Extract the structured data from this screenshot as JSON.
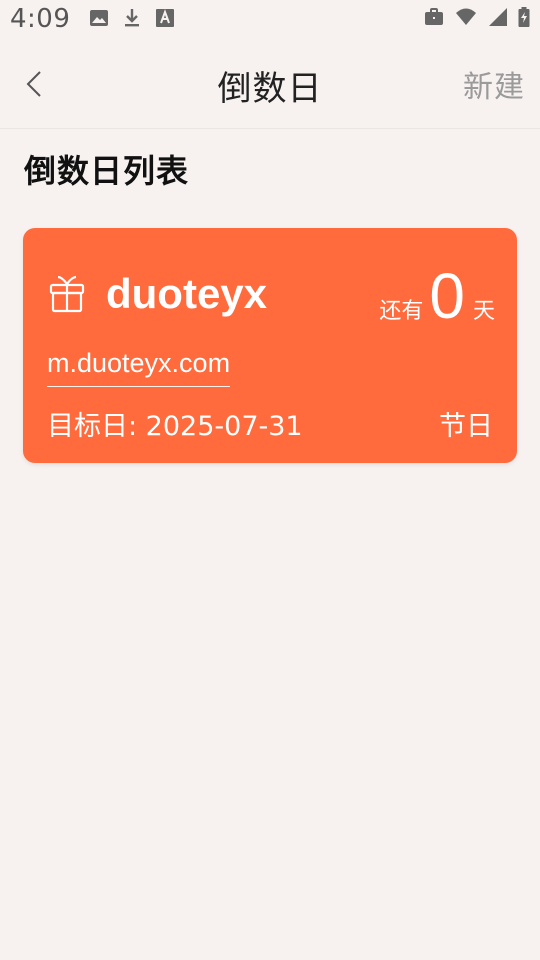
{
  "status_bar": {
    "time": "4:09",
    "left_icons": [
      "image-icon",
      "download-icon",
      "font-a-icon"
    ],
    "right_icons": [
      "briefcase-icon",
      "wifi-icon",
      "signal-icon",
      "battery-icon"
    ]
  },
  "app_bar": {
    "back_icon": "chevron-left-icon",
    "title": "倒数日",
    "action_label": "新建"
  },
  "section": {
    "title": "倒数日列表"
  },
  "card": {
    "icon": "gift-icon",
    "title": "duoteyx",
    "remaining_prefix": "还有",
    "remaining_days": "0",
    "remaining_unit": "天",
    "subtitle": "m.duoteyx.com",
    "target_date_label": "目标日: 2025-07-31",
    "category": "节日",
    "background_color": "#ff6b3d",
    "text_color": "#ffffff"
  },
  "colors": {
    "page_background": "#f7f1f0",
    "accent": "#ff6b3d",
    "muted_text": "#9a9a9a"
  }
}
